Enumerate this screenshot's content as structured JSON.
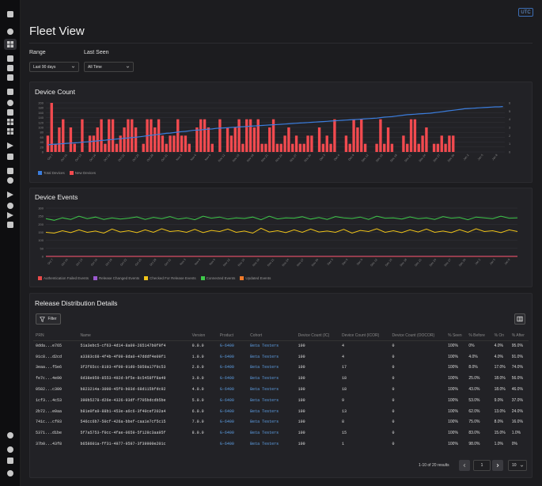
{
  "page": {
    "title": "Fleet View",
    "utc_label": "UTC"
  },
  "sidebar": {
    "icons": [
      "home-icon",
      "search-icon",
      "analytics-icon",
      "inbox-icon",
      "box-icon",
      "stack-icon",
      "layers-icon",
      "gear-icon",
      "briefcase-icon",
      "grid-icon",
      "cluster-icon",
      "rocket-icon",
      "truck-icon",
      "document-icon",
      "location-icon",
      "send-icon",
      "users-icon",
      "wrench-icon",
      "edit-icon",
      "shield-icon",
      "user-icon",
      "layers-bottom-icon",
      "circle-icon",
      "expand-icon"
    ]
  },
  "filters": {
    "range_label": "Range",
    "range_value": "Last 90 days",
    "last_seen_label": "Last Seen",
    "last_seen_value": "All Time"
  },
  "device_count": {
    "title": "Device Count",
    "legend": [
      {
        "name": "Total Devices",
        "color": "#3b7ddd"
      },
      {
        "name": "New Devices",
        "color": "#f24a4f"
      }
    ]
  },
  "device_events": {
    "title": "Device Events",
    "legend": [
      {
        "name": "Authentication Failed Events",
        "color": "#e84a4a"
      },
      {
        "name": "Release Changed Events",
        "color": "#9b59d0"
      },
      {
        "name": "Checked For Release Events",
        "color": "#f0c419"
      },
      {
        "name": "Connected Events",
        "color": "#3ec94a"
      },
      {
        "name": "Updated Events",
        "color": "#f07a2a"
      }
    ]
  },
  "chart_data": [
    {
      "type": "bar",
      "title": "Device Count",
      "x": [
        "Oct 7",
        "Oct 10",
        "Oct 13",
        "Oct 16",
        "Oct 19",
        "Oct 22",
        "Oct 25",
        "Oct 28",
        "Oct 31",
        "Nov 3",
        "Nov 6",
        "Nov 9",
        "Nov 12",
        "Nov 15",
        "Nov 18",
        "Nov 21",
        "Nov 24",
        "Nov 27",
        "Nov 30",
        "Dec 3",
        "Dec 6",
        "Dec 9",
        "Dec 12",
        "Dec 15",
        "Dec 18",
        "Dec 21",
        "Dec 24",
        "Dec 27",
        "Dec 30",
        "Jan 2",
        "Jan 5",
        "Jan 8"
      ],
      "ylim": [
        0,
        200
      ],
      "y_ticks": [
        0,
        20,
        40,
        60,
        80,
        100,
        120,
        140,
        160,
        180,
        200
      ],
      "y2lim": [
        0,
        6
      ],
      "y2_ticks": [
        0,
        1,
        2,
        3,
        4,
        5,
        6
      ],
      "series": [
        {
          "name": "New Devices",
          "axis": "right",
          "values": [
            2,
            6,
            1,
            3,
            4,
            0,
            3,
            1,
            0,
            4,
            0,
            2,
            2,
            3,
            4,
            1,
            4,
            4,
            1,
            2,
            3,
            4,
            4,
            3,
            0,
            1,
            4,
            4,
            3,
            4,
            2,
            1,
            2,
            2,
            4,
            2,
            2,
            1,
            0,
            3,
            4,
            4,
            3,
            1,
            0,
            4,
            0,
            3,
            2,
            3,
            4,
            1,
            4,
            4,
            3,
            4,
            1,
            1,
            3,
            4,
            1,
            1,
            2,
            3,
            1,
            2,
            1,
            1,
            2,
            2,
            0,
            3,
            1,
            2,
            1,
            4,
            0,
            0,
            2,
            1,
            4,
            3,
            4,
            1,
            0,
            0,
            1,
            4,
            1,
            3,
            1,
            0,
            0,
            2,
            1,
            4,
            4,
            1,
            2,
            3,
            0,
            1,
            1,
            2,
            1,
            2,
            2,
            0,
            0,
            0,
            0,
            0,
            0,
            0,
            0,
            0,
            0,
            0,
            0,
            0
          ]
        },
        {
          "name": "Total Devices",
          "axis": "left",
          "values": [
            29,
            31,
            32,
            33,
            34,
            35,
            36,
            37,
            38,
            40,
            41,
            42,
            44,
            45,
            47,
            48,
            50,
            51,
            53,
            54,
            56,
            57,
            59,
            60,
            62,
            64,
            66,
            68,
            70,
            72,
            74,
            76,
            77,
            79,
            81,
            83,
            84,
            86,
            88,
            89,
            90,
            92,
            93,
            94,
            96,
            97,
            98,
            99,
            100,
            101,
            102,
            103,
            104,
            105,
            106,
            107,
            108,
            109,
            110,
            111,
            112,
            113,
            114,
            115,
            116,
            117,
            118,
            119,
            120,
            121,
            122,
            123,
            124,
            125,
            126,
            127,
            128,
            129,
            130,
            131,
            132,
            133,
            134,
            135,
            136,
            137,
            138,
            140,
            142,
            143,
            144,
            146,
            148,
            150,
            152,
            153,
            154,
            155,
            156,
            157,
            158,
            160,
            162,
            164,
            166,
            168,
            170,
            172,
            174,
            176,
            177,
            178,
            179,
            180,
            181,
            182,
            183,
            184,
            184,
            185
          ]
        }
      ]
    },
    {
      "type": "line",
      "title": "Device Events",
      "x": [
        "Oct 7",
        "Oct 10",
        "Oct 13",
        "Oct 16",
        "Oct 19",
        "Oct 22",
        "Oct 25",
        "Oct 28",
        "Oct 31",
        "Nov 3",
        "Nov 6",
        "Nov 9",
        "Nov 12",
        "Nov 15",
        "Nov 18",
        "Nov 21",
        "Nov 24",
        "Nov 27",
        "Nov 30",
        "Dec 3",
        "Dec 6",
        "Dec 9",
        "Dec 12",
        "Dec 15",
        "Dec 18",
        "Dec 21",
        "Dec 24",
        "Dec 27",
        "Dec 30",
        "Jan 2",
        "Jan 5",
        "Jan 8"
      ],
      "ylim": [
        0,
        300
      ],
      "y_ticks": [
        0,
        50,
        100,
        150,
        200,
        250,
        300
      ],
      "series": [
        {
          "name": "Connected Events",
          "values": [
            235,
            225,
            240,
            230,
            250,
            235,
            245,
            230,
            240,
            232,
            238,
            246,
            230,
            243,
            235,
            248,
            232,
            240,
            228,
            250,
            238,
            245,
            232,
            240,
            236,
            245,
            228,
            250,
            233,
            240,
            238,
            247,
            232,
            242,
            230,
            248,
            240,
            236,
            245,
            230,
            250,
            238,
            240,
            232,
            246,
            235,
            240,
            230,
            248,
            238,
            242,
            228,
            245,
            240,
            235,
            250,
            238,
            240
          ]
        },
        {
          "name": "Checked For Release Events",
          "values": [
            150,
            145,
            160,
            148,
            165,
            150,
            158,
            145,
            170,
            152,
            160,
            148,
            165,
            150,
            172,
            155,
            160,
            150,
            168,
            148,
            162,
            155,
            170,
            150,
            158,
            145,
            175,
            152,
            160,
            148,
            165,
            150,
            170,
            152,
            158,
            150,
            168,
            145,
            162,
            155,
            172,
            150,
            160,
            148,
            165,
            152,
            170,
            150,
            158,
            148,
            166,
            150,
            172,
            155,
            160,
            148,
            165,
            155
          ]
        },
        {
          "name": "Updated Events",
          "values": [
            0,
            0,
            0,
            0,
            0,
            0,
            0,
            0,
            0,
            0,
            0,
            0,
            0,
            0,
            0,
            0,
            0,
            0,
            0,
            0,
            0,
            0,
            0,
            0,
            0,
            0,
            0,
            0,
            0,
            0,
            0,
            0,
            0,
            0,
            0,
            0,
            0,
            0,
            0,
            0,
            0,
            0,
            0,
            0,
            0,
            0,
            0,
            0,
            0,
            0,
            0,
            0,
            0,
            0,
            0,
            0,
            0,
            0
          ]
        },
        {
          "name": "Release Changed Events",
          "values": [
            1,
            1,
            1,
            1,
            1,
            1,
            1,
            1,
            1,
            1,
            1,
            1,
            1,
            1,
            1,
            1,
            1,
            1,
            1,
            1,
            1,
            1,
            1,
            1,
            1,
            1,
            1,
            1,
            1,
            1,
            1,
            1,
            1,
            1,
            1,
            1,
            1,
            1,
            1,
            1,
            1,
            1,
            1,
            1,
            1,
            1,
            1,
            1,
            1,
            1,
            1,
            1,
            1,
            1,
            1,
            1,
            1,
            1
          ]
        },
        {
          "name": "Authentication Failed Events",
          "values": [
            0,
            0,
            0,
            0,
            0,
            0,
            0,
            0,
            0,
            0,
            0,
            0,
            0,
            0,
            0,
            0,
            0,
            0,
            0,
            0,
            0,
            0,
            0,
            0,
            0,
            0,
            0,
            0,
            0,
            0,
            0,
            0,
            0,
            0,
            0,
            0,
            0,
            0,
            0,
            0,
            0,
            0,
            0,
            0,
            0,
            0,
            0,
            0,
            0,
            0,
            0,
            0,
            0,
            0,
            0,
            0,
            0,
            0
          ]
        }
      ]
    }
  ],
  "release": {
    "title": "Release Distribution Details",
    "filter_label": "Filter",
    "columns": [
      "PRN",
      "Name",
      "Version",
      "Product",
      "Cohort",
      "Device Count (IC)",
      "Device Count (ICOR)",
      "Device Count (OOCOR)",
      "% Seen",
      "% Before",
      "% On",
      "% After"
    ],
    "rows": [
      [
        "0dda...e765",
        "51a3ebc5-cf63-4d14-8a09-265147b0f9f4",
        "0.0.0",
        "G-6400",
        "Beta Testers",
        "100",
        "4",
        "0",
        "100%",
        "0%",
        "4.0%",
        "95.0%"
      ],
      [
        "91c8...d2cd",
        "a3383c68-4f4b-4f09-8da0-47dddf4e09f1",
        "1.0.0",
        "G-6400",
        "Beta Testers",
        "100",
        "4",
        "0",
        "100%",
        "4.0%",
        "4.0%",
        "91.0%"
      ],
      [
        "3eaa...f5e6",
        "3f2f65cc-8193-4f09-91d0-5059a17f9c53",
        "2.0.0",
        "G-6400",
        "Beta Testers",
        "100",
        "17",
        "0",
        "100%",
        "8.0%",
        "17.0%",
        "74.0%"
      ],
      [
        "fe7c...4e90",
        "6d38e959-8553-492d-bf5e-8c5458ff8a49",
        "3.0.0",
        "G-6400",
        "Beta Testers",
        "100",
        "18",
        "0",
        "100%",
        "25.0%",
        "18.0%",
        "56.0%"
      ],
      [
        "0582...c309",
        "b823214a-3000-45f0-b03d-68d115bfdc92",
        "4.0.0",
        "G-6400",
        "Beta Testers",
        "100",
        "18",
        "0",
        "100%",
        "43.0%",
        "18.0%",
        "46.0%"
      ],
      [
        "1cf3...4c53",
        "390b5278-d26e-4326-93df-f705bdcdb5be",
        "5.0.0",
        "G-6400",
        "Beta Testers",
        "100",
        "9",
        "0",
        "100%",
        "53.0%",
        "9.0%",
        "37.0%"
      ],
      [
        "2b72...e0aa",
        "b81e0fa9-88b1-453e-a6c6-3f40cef202a4",
        "6.0.0",
        "G-6400",
        "Beta Testers",
        "100",
        "13",
        "0",
        "100%",
        "62.0%",
        "13.0%",
        "24.0%"
      ],
      [
        "741c...cf93",
        "546cc6b7-50cf-426a-bbef-caa1e7cf5c15",
        "7.0.0",
        "G-6400",
        "Beta Testers",
        "100",
        "8",
        "0",
        "100%",
        "75.0%",
        "8.0%",
        "16.0%"
      ],
      [
        "5371...d1be",
        "5f7a5753-f0cc-4fae-0659-5f128c3aa95f",
        "8.0.0",
        "G-6400",
        "Beta Testers",
        "100",
        "15",
        "0",
        "100%",
        "83.0%",
        "15.0%",
        "1.0%"
      ],
      [
        "37b0...43f8",
        "b658601a-ff31-4977-9597-3f39900e201c",
        "",
        "G-6400",
        "Beta Testers",
        "100",
        "1",
        "0",
        "100%",
        "98.0%",
        "1.0%",
        "0%"
      ]
    ],
    "pagination": {
      "summary": "1-10 of 20 results",
      "page": "1",
      "page_size": "10"
    }
  }
}
